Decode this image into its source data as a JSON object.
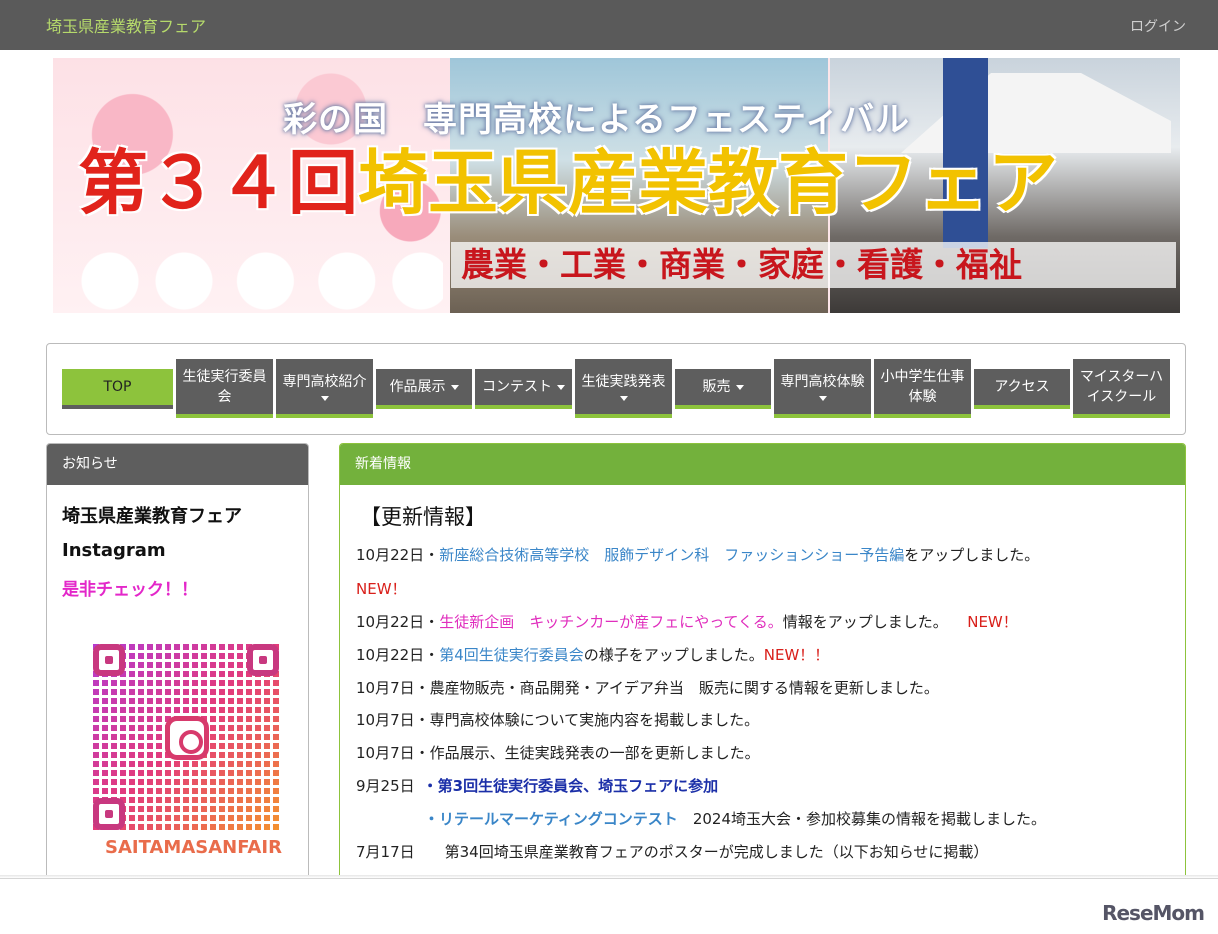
{
  "header": {
    "site_title": "埼玉県産業教育フェア",
    "login": "ログイン"
  },
  "banner": {
    "subtitle": "彩の国　専門高校によるフェスティバル",
    "title_red": "第３４回",
    "title_gold": "埼玉県産業教育フェア",
    "categories": "農業・工業・商業・家庭・看護・福祉"
  },
  "nav": {
    "items": [
      {
        "label": "TOP"
      },
      {
        "label": "生徒実行委員会"
      },
      {
        "label": "専門高校紹介"
      },
      {
        "label": "作品展示"
      },
      {
        "label": "コンテスト"
      },
      {
        "label": "生徒実践発表"
      },
      {
        "label": "販売"
      },
      {
        "label": "専門高校体験"
      },
      {
        "label": "小中学生仕事体験"
      },
      {
        "label": "アクセス"
      },
      {
        "label": "マイスターハイスクール"
      }
    ]
  },
  "sidebar": {
    "heading": "お知らせ",
    "line1": "埼玉県産業教育フェア",
    "line2": "Instagram",
    "line3": "是非チェック！！",
    "qr_handle": "SAITAMASANFAIR",
    "icons": [
      "qr-code-icon",
      "instagram-icon"
    ]
  },
  "main": {
    "heading": "新着情報",
    "title": "【更新情報】",
    "news": [
      {
        "date": "10月22日・",
        "link": "新座総合技術高等学校　服飾デザイン科　ファッションショー予告編",
        "rest": "をアップしました。",
        "new": "NEW！"
      },
      {
        "date": "10月22日・",
        "link": "生徒新企画　キッチンカーが産フェにやってくる。",
        "rest": "情報をアップしました。　",
        "new": "NEW！"
      },
      {
        "date": "10月22日・",
        "link": "第4回生徒実行委員会",
        "rest": "の様子をアップしました。",
        "new": "NEW！！"
      },
      {
        "text": "10月7日・農産物販売・商品開発・アイデア弁当　販売に関する情報を更新しました。"
      },
      {
        "text": "10月7日・専門高校体験について実施内容を掲載しました。"
      },
      {
        "text": "10月7日・作品展示、生徒実践発表の一部を更新しました。"
      },
      {
        "date": "9月25日",
        "link": "・第3回生徒実行委員会、埼玉フェアに参加"
      },
      {
        "link": "・リテールマーケティングコンテスト",
        "rest": "　2024埼玉大会・参加校募集の情報を掲載しました。"
      },
      {
        "date": "7月17日",
        "rest": "第34回埼玉県産業教育フェアのポスターが完成しました（以下お知らせに掲載）"
      }
    ]
  },
  "footer": {
    "brand": "ReseMom"
  }
}
